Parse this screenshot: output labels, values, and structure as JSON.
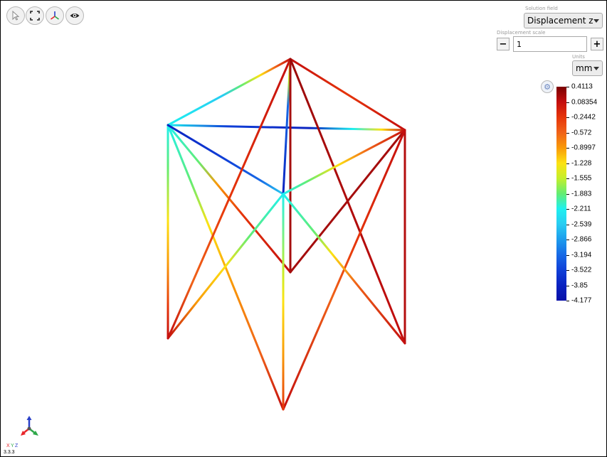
{
  "toolbar": {
    "buttons": [
      {
        "name": "select-tool-button",
        "icon": "cursor-icon"
      },
      {
        "name": "fit-view-button",
        "icon": "fit-view-icon"
      },
      {
        "name": "axes-view-button",
        "icon": "axes-triad-icon"
      },
      {
        "name": "visibility-button",
        "icon": "eye-icon"
      }
    ]
  },
  "panel": {
    "solution_field_label": "Solution field",
    "solution_field_value": "Displacement z",
    "displacement_scale_label": "Displacement scale",
    "displacement_scale_value": "1",
    "minus_label": "−",
    "plus_label": "+",
    "units_label": "Units",
    "units_value": "mm"
  },
  "legend": {
    "settings_icon": "gear-icon",
    "values": [
      "0.4113",
      "0.08354",
      "-0.2442",
      "-0.572",
      "-0.8997",
      "-1.228",
      "-1.555",
      "-1.883",
      "-2.211",
      "-2.539",
      "-2.866",
      "-3.194",
      "-3.522",
      "-3.85",
      "-4.177"
    ],
    "colors": [
      "#7a0000",
      "#c40e0e",
      "#e6350a",
      "#f06218",
      "#f99a08",
      "#fde212",
      "#c3ef2b",
      "#63ed72",
      "#1ef0f0",
      "#28ccf2",
      "#1c9ced",
      "#1769e6",
      "#1040d8",
      "#0a22c0",
      "#0810a8"
    ]
  },
  "triad": {
    "x_label": "X",
    "y_label": "Y",
    "z_label": "Z",
    "x_color": "#e8262b",
    "y_color": "#2fa84a",
    "z_color": "#2a40c8"
  },
  "coordinates": "3.3.3"
}
